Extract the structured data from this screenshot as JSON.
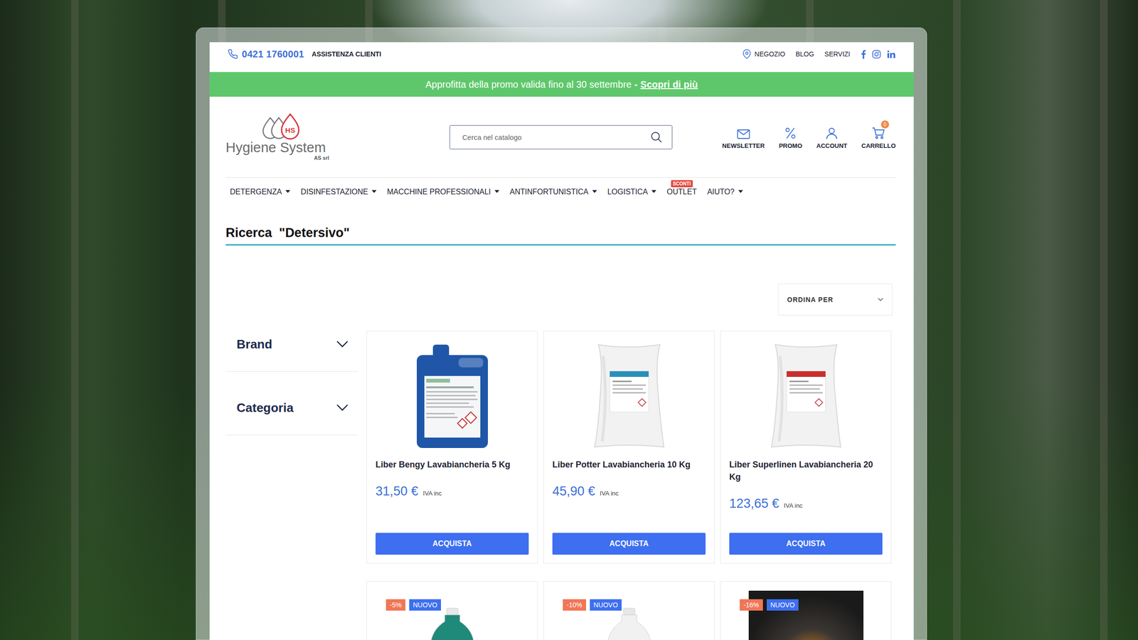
{
  "topbar": {
    "phone": "0421 1760001",
    "support": "ASSISTENZA CLIENTI",
    "links": [
      "NEGOZIO",
      "BLOG",
      "SERVIZI"
    ]
  },
  "promo": {
    "text": "Approfitta della promo valida fino al 30 settembre",
    "separator": "-",
    "link": "Scopri di più"
  },
  "logo": {
    "mark": "HS",
    "name": "Hygiene System",
    "sub": "AS srl"
  },
  "search": {
    "placeholder": "Cerca nel catalogo"
  },
  "actions": [
    {
      "label": "NEWSLETTER"
    },
    {
      "label": "PROMO"
    },
    {
      "label": "ACCOUNT"
    },
    {
      "label": "CARRELLO",
      "badge": "0"
    }
  ],
  "nav": [
    {
      "label": "DETERGENZA",
      "dropdown": true
    },
    {
      "label": "DISINFESTAZIONE",
      "dropdown": true
    },
    {
      "label": "MACCHINE PROFESSIONALI",
      "dropdown": true
    },
    {
      "label": "ANTINFORTUNISTICA",
      "dropdown": true
    },
    {
      "label": "LOGISTICA",
      "dropdown": true
    },
    {
      "label": "OUTLET",
      "dropdown": false,
      "badge": "SCONTI"
    },
    {
      "label": "AIUTO?",
      "dropdown": true
    }
  ],
  "page_title": "Ricerca  \"Detersivo\"",
  "sort": {
    "label": "ORDINA PER"
  },
  "filters": [
    {
      "label": "Brand",
      "expanded": false
    },
    {
      "label": "Categoria",
      "expanded": false
    }
  ],
  "products": [
    {
      "kind": "tank",
      "color": "#1f56a8",
      "name": "Liber Bengy Lavabiancheria 5 Kg",
      "price": "31,50 €",
      "vat": "IVA inc",
      "button": "ACQUISTA"
    },
    {
      "kind": "bag",
      "color": "#2a8fb8",
      "name": "Liber Potter Lavabiancheria 10 Kg",
      "price": "45,90 €",
      "vat": "IVA inc",
      "button": "ACQUISTA"
    },
    {
      "kind": "bag",
      "color": "#c9302c",
      "name": "Liber Superlinen Lavabiancheria 20 Kg",
      "price": "123,65 €",
      "vat": "IVA inc",
      "button": "ACQUISTA"
    },
    {
      "kind": "bottle",
      "color": "#1f8a7a",
      "discount": "-5%",
      "badge": "NUOVO"
    },
    {
      "kind": "bottle",
      "color": "#f1f1f1",
      "discount": "-10%",
      "badge": "NUOVO"
    },
    {
      "kind": "photo",
      "color": "#2a2a2a",
      "discount": "-16%",
      "badge": "NUOVO"
    }
  ]
}
